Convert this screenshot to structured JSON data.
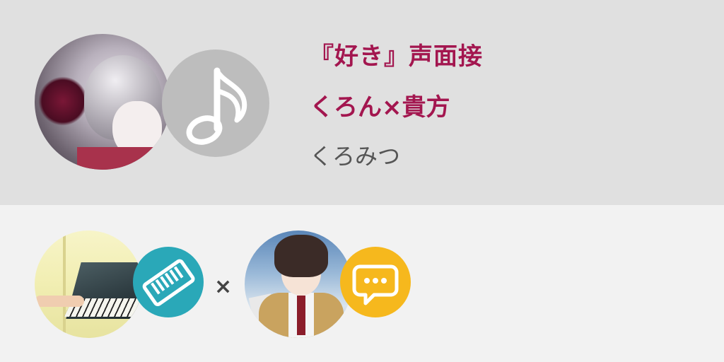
{
  "song": {
    "title": "『好き』声面接",
    "collab": "くろん×貴方",
    "artist": "くろみつ"
  },
  "participants": {
    "separator": "×",
    "first": {
      "role_icon": "keyboard-icon",
      "color": "#2aa8b8"
    },
    "second": {
      "role_icon": "chat-bubble-icon",
      "color": "#f6b81d"
    }
  },
  "colors": {
    "accent": "#a3164f",
    "top_background": "#e0e0e0",
    "bottom_background": "#f2f2f2",
    "music_badge": "#bdbdbd"
  },
  "icons": {
    "main_badge": "music-note-icon"
  }
}
